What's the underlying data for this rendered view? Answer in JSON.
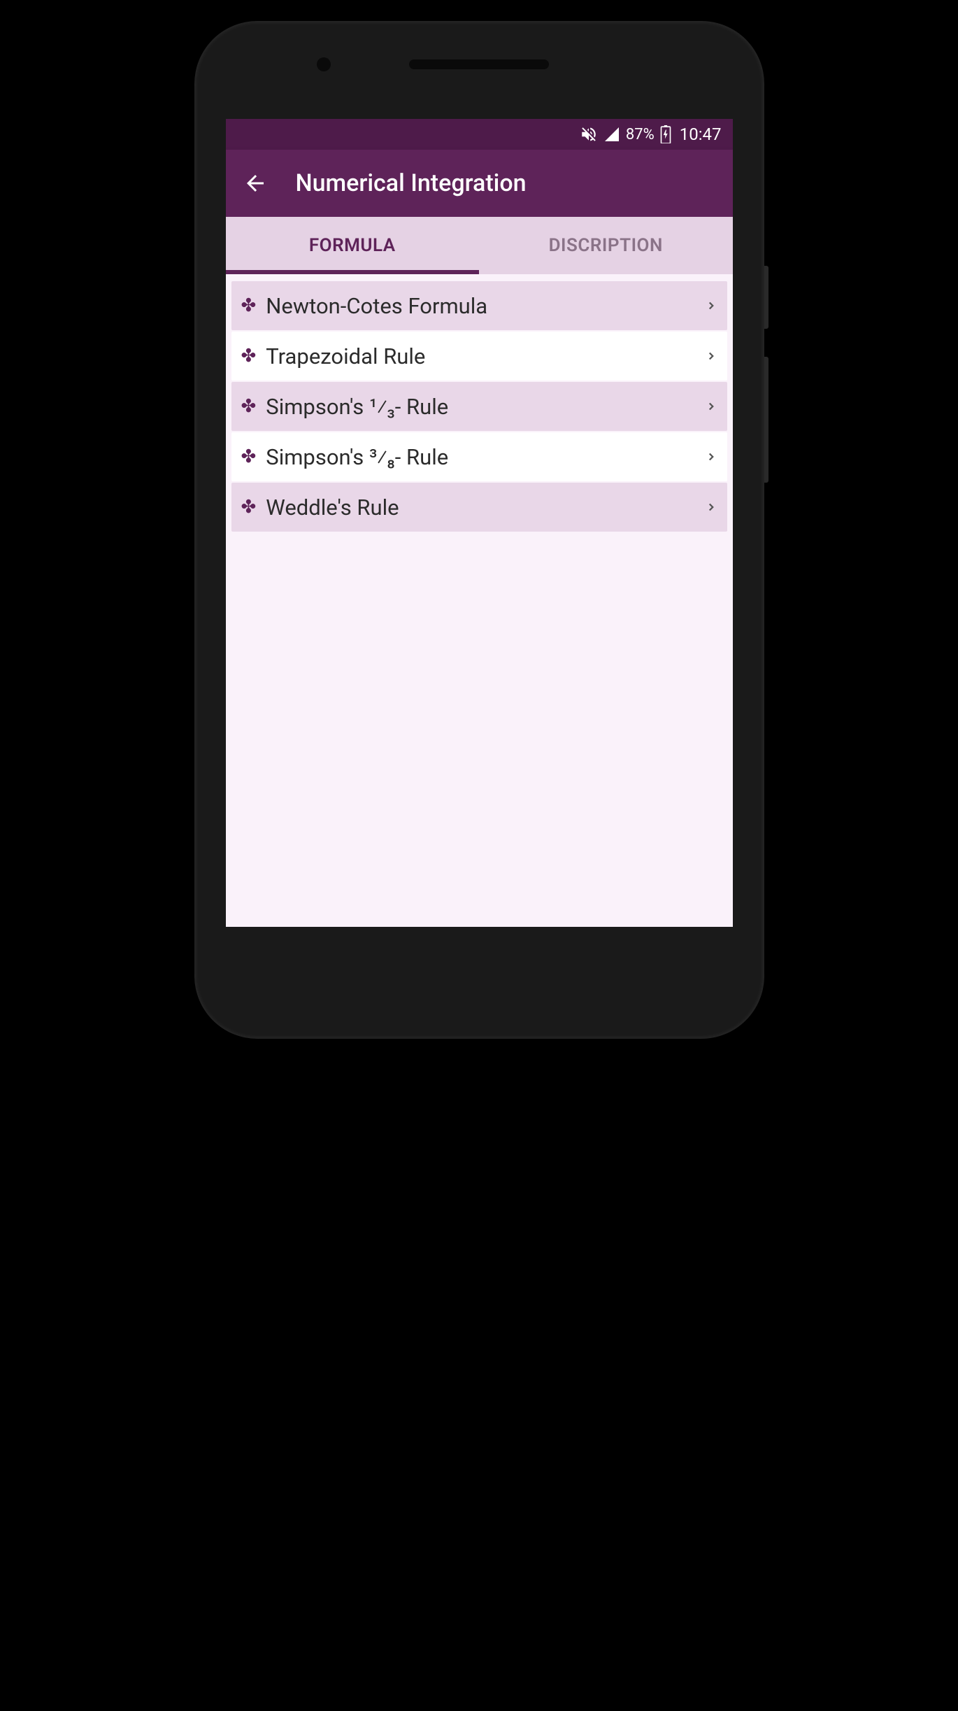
{
  "status": {
    "battery": "87%",
    "time": "10:47"
  },
  "header": {
    "title": "Numerical Integration"
  },
  "tabs": {
    "items": [
      {
        "label": "FORMULA",
        "active": true
      },
      {
        "label": "DISCRIPTION",
        "active": false
      }
    ]
  },
  "list": {
    "items": [
      {
        "label": "Newton-Cotes Formula"
      },
      {
        "label": "Trapezoidal Rule"
      },
      {
        "label": "Simpson's ¹⁄₃- Rule"
      },
      {
        "label": "Simpson's ³⁄₈- Rule"
      },
      {
        "label": "Weddle's Rule"
      }
    ]
  }
}
